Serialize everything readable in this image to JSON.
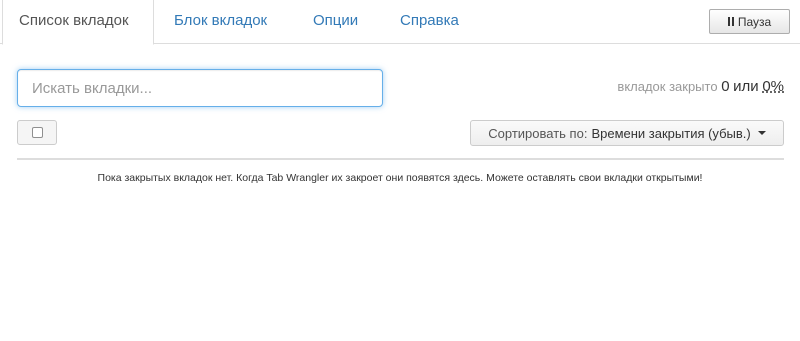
{
  "nav": {
    "tabs": [
      {
        "label": "Список вкладок",
        "active": true
      },
      {
        "label": "Блок вкладок",
        "active": false
      },
      {
        "label": "Опции",
        "active": false
      },
      {
        "label": "Справка",
        "active": false
      }
    ],
    "pause": {
      "label": "Пауза",
      "icon": "pause-icon"
    }
  },
  "search": {
    "value": "",
    "placeholder": "Искать вкладки..."
  },
  "stats": {
    "prefix": "вкладок закрыто",
    "count": "0",
    "separator": "или",
    "percent": "0%"
  },
  "toolbar": {
    "select_all_checked": false,
    "sort": {
      "prefix": "Сортировать по:",
      "value": "Времени закрытия (убыв.)",
      "icon": "caret-down-icon"
    }
  },
  "empty_message": "Пока закрытых вкладок нет. Когда Tab Wrangler их закроет они появятся здесь. Можете оставлять свои вкладки открытыми!",
  "colors": {
    "link": "#337ab7",
    "focus_border": "#66afe9",
    "divider": "#dddddd"
  }
}
